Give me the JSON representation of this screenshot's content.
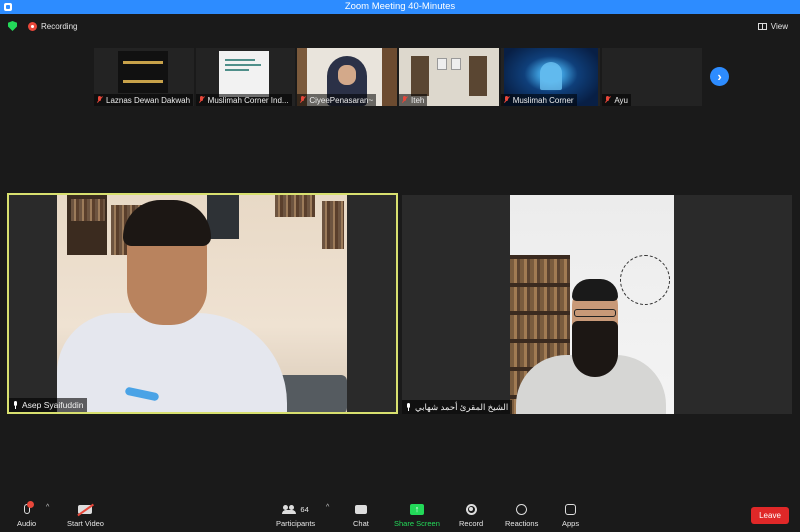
{
  "window": {
    "title": "Zoom Meeting 40-Minutes"
  },
  "top_bar": {
    "recording_label": "Recording",
    "view_label": "View"
  },
  "thumbnails": [
    {
      "name": "Laznas Dewan Dakwah",
      "mic": "muted"
    },
    {
      "name": "Muslimah Corner Ind...",
      "mic": "muted"
    },
    {
      "name": "CiyeePenasaran~",
      "mic": "muted"
    },
    {
      "name": "Iteh",
      "mic": "muted"
    },
    {
      "name": "Muslimah Corner",
      "mic": "muted"
    },
    {
      "name": "Ayu",
      "mic": "muted"
    }
  ],
  "main_tiles": [
    {
      "name": "Asep Syaifuddin",
      "mic": "live",
      "active_speaker": true
    },
    {
      "name": "الشيخ المقرئ أحمد شهابي",
      "mic": "live",
      "active_speaker": false
    }
  ],
  "toolbar": {
    "audio_label": "Audio",
    "start_video_label": "Start Video",
    "participants_label": "Participants",
    "participants_count": "64",
    "chat_label": "Chat",
    "share_screen_label": "Share Screen",
    "record_label": "Record",
    "reactions_label": "Reactions",
    "apps_label": "Apps",
    "leave_label": "Leave"
  },
  "colors": {
    "title_bar": "#2d8cff",
    "active_speaker_border": "#d8e06f",
    "share_green": "#23d959",
    "leave_red": "#e02828",
    "muted_red": "#e8473a"
  },
  "icons": [
    "zoom-app-icon",
    "shield-icon",
    "recording-icon",
    "view-grid-icon",
    "mic-icon",
    "video-off-icon",
    "participants-icon",
    "chat-icon",
    "share-screen-icon",
    "record-icon",
    "reactions-icon",
    "apps-icon",
    "next-page-arrow-icon"
  ]
}
